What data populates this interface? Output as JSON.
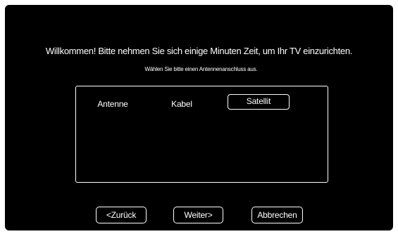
{
  "screen": {
    "welcome_text": "Willkommen! Bitte nehmen Sie sich einige Minuten Zeit, um Ihr TV einzurichten.",
    "subtitle_text": "Wählen Sie bitte einen Antennenanschluss aus."
  },
  "options": {
    "antenne": "Antenne",
    "kabel": "Kabel",
    "satellit": "Satellit",
    "selected": "Satellit"
  },
  "buttons": {
    "back": "<Zurück",
    "next": "Weiter>",
    "cancel": "Abbrechen"
  },
  "colors": {
    "background": "#000000",
    "foreground": "#ffffff"
  }
}
